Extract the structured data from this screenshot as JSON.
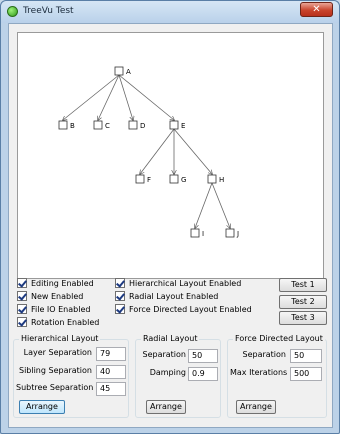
{
  "window": {
    "title": "TreeVu Test",
    "close_glyph": "✕"
  },
  "tree": {
    "nodes": [
      {
        "id": "A",
        "label": "A"
      },
      {
        "id": "B",
        "label": "B"
      },
      {
        "id": "C",
        "label": "C"
      },
      {
        "id": "D",
        "label": "D"
      },
      {
        "id": "E",
        "label": "E"
      },
      {
        "id": "F",
        "label": "F"
      },
      {
        "id": "G",
        "label": "G"
      },
      {
        "id": "H",
        "label": "H"
      },
      {
        "id": "I",
        "label": "I"
      },
      {
        "id": "J",
        "label": "J"
      }
    ],
    "edges": [
      [
        "A",
        "B"
      ],
      [
        "A",
        "C"
      ],
      [
        "A",
        "D"
      ],
      [
        "A",
        "E"
      ],
      [
        "E",
        "F"
      ],
      [
        "E",
        "G"
      ],
      [
        "E",
        "H"
      ],
      [
        "H",
        "I"
      ],
      [
        "H",
        "J"
      ]
    ]
  },
  "options": {
    "left": [
      {
        "label": "Editing Enabled",
        "checked": true
      },
      {
        "label": "New Enabled",
        "checked": true
      },
      {
        "label": "File IO Enabled",
        "checked": true
      },
      {
        "label": "Rotation Enabled",
        "checked": true
      }
    ],
    "right": [
      {
        "label": "Hierarchical Layout Enabled",
        "checked": true
      },
      {
        "label": "Radial Layout Enabled",
        "checked": true
      },
      {
        "label": "Force Directed Layout Enabled",
        "checked": true
      }
    ]
  },
  "tests": {
    "test1": "Test 1",
    "test2": "Test 2",
    "test3": "Test 3"
  },
  "hierarchical": {
    "title": "Hierarchical Layout",
    "layer_label": "Layer Separation",
    "layer_value": "79",
    "sibling_label": "Sibling Separation",
    "sibling_value": "40",
    "subtree_label": "Subtree Separation",
    "subtree_value": "45",
    "arrange": "Arrange"
  },
  "radial": {
    "title": "Radial Layout",
    "separation_label": "Separation",
    "separation_value": "50",
    "damping_label": "Damping",
    "damping_value": "0.9",
    "arrange": "Arrange"
  },
  "force": {
    "title": "Force Directed Layout",
    "separation_label": "Separation",
    "separation_value": "50",
    "iterations_label": "Max Iterations",
    "iterations_value": "500",
    "arrange": "Arrange"
  }
}
